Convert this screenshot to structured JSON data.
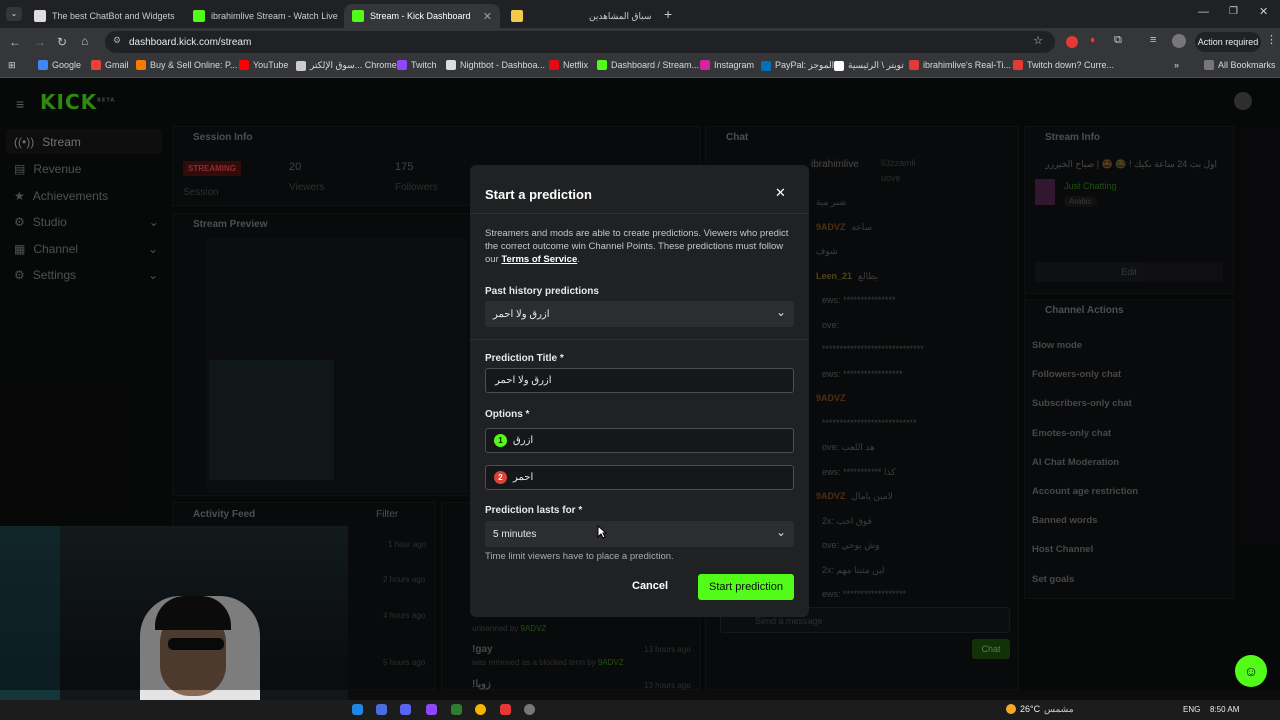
{
  "browser": {
    "tabs": [
      {
        "title": "The best ChatBot and Widgets",
        "color": "#ffffff"
      },
      {
        "title": "ibrahimlive Stream - Watch Live",
        "color": "#53fc18"
      },
      {
        "title": "Stream - Kick Dashboard",
        "color": "#53fc18"
      },
      {
        "title": "سباق المشاهدين",
        "color": "#f2c94c"
      }
    ],
    "url": "dashboard.kick.com/stream",
    "action_required": "Action required",
    "bookmarks": [
      "Google",
      "Gmail",
      "Buy & Sell Online: P...",
      "YouTube",
      "سوق الإلكتر... Chrome",
      "Twitch",
      "Nightbot - Dashboa...",
      "Netflix",
      "Dashboard / Stream...",
      "Instagram",
      "PayPal: الموجز",
      "تويتر \\ الرئيسية",
      "ibrahimlive's Real-Ti...",
      "Twitch down? Curre..."
    ],
    "all_bookmarks": "All Bookmarks"
  },
  "kick": {
    "logo": "KICK",
    "logo_sup": "BETA",
    "sidebar": [
      "Stream",
      "Revenue",
      "Achievements",
      "Studio",
      "Channel",
      "Settings"
    ],
    "session": {
      "title": "Session Info",
      "badge": "STREAMING",
      "session_label": "Session",
      "viewers": "20",
      "viewers_label": "Viewers",
      "followers": "175",
      "followers_label": "Followers"
    },
    "preview_title": "Stream Preview",
    "activity": {
      "title": "Activity Feed",
      "filter": "Filter",
      "times": [
        "1 hour ago",
        "2 hours ago",
        "4 hours ago",
        "5 hours ago"
      ]
    },
    "mod_feed": [
      {
        "text": "unbanned by",
        "user": "9ADVZ",
        "time": ""
      },
      {
        "text": "!gay",
        "sub": "was removed as a blocked term by",
        "user": "9ADVZ",
        "time": "13 hours ago"
      },
      {
        "text": "!زوبا",
        "time": "13 hours ago"
      }
    ],
    "chat": {
      "title": "Chat",
      "top_users": [
        "ibrahimlive",
        "li3zzamli",
        "uove"
      ],
      "messages": [
        {
          "user": "",
          "text": "شبر مية",
          "color": "#f48c1f"
        },
        {
          "user": "9ADVZ",
          "text": "ساعه",
          "color": "#f48c1f"
        },
        {
          "user": "",
          "text": "شوف",
          "color": "#ffffff"
        },
        {
          "user": "Leen_21",
          "text": "يطالع",
          "color": "#f2d542"
        },
        {
          "user": "",
          "text": "ews: ***************",
          "color": "#53fc18"
        },
        {
          "user": "",
          "text": "ove:",
          "color": "#3fa4ff"
        },
        {
          "user": "",
          "text": "*****************************",
          "color": "#53fc18"
        },
        {
          "user": "",
          "text": "ews: *****************",
          "color": "#53fc18"
        },
        {
          "user": "9ADVZ",
          "text": "",
          "color": "#f48c1f"
        },
        {
          "user": "",
          "text": "***************************",
          "color": "#53fc18"
        },
        {
          "user": "",
          "text": "ove: هد اللعب",
          "color": "#3fa4ff"
        },
        {
          "user": "",
          "text": "ews: *********** كذا",
          "color": "#53fc18"
        },
        {
          "user": "9ADVZ",
          "text": "لامين يامال",
          "color": "#f48c1f"
        },
        {
          "user": "",
          "text": "2x: فوق احب",
          "color": "#e53935"
        },
        {
          "user": "",
          "text": "ove: وش يوحي",
          "color": "#3fa4ff"
        },
        {
          "user": "",
          "text": "2x: لين مثبتا مهم",
          "color": "#e53935"
        },
        {
          "user": "",
          "text": "ews: ******************",
          "color": "#53fc18"
        }
      ],
      "placeholder": "Send a message",
      "send": "Chat"
    },
    "stream_info": {
      "title": "Stream Info",
      "stream_title": "اول بث 24 ساعة بكيك ! 😂 🤩 | صباح الخيررر",
      "category": "Just Chatting",
      "language": "Arabic",
      "edit": "Edit"
    },
    "channel_actions": {
      "title": "Channel Actions",
      "items": [
        "Slow mode",
        "Followers-only chat",
        "Subscribers-only chat",
        "Emotes-only chat",
        "AI Chat Moderation",
        "Account age restriction",
        "Banned words",
        "Host Channel",
        "Set goals"
      ]
    }
  },
  "modal": {
    "title": "Start a prediction",
    "description": "Streamers and mods are able to create predictions. Viewers who predict the correct outcome win Channel Points. These predictions must follow our",
    "tos": "Terms of Service",
    "history_label": "Past history predictions",
    "history_value": "ازرق ولا احمر",
    "title_label": "Prediction Title *",
    "title_value": "ازرق ولا احمر",
    "options_label": "Options *",
    "options": [
      {
        "num": "1",
        "value": "ازرق",
        "color": "#53fc18"
      },
      {
        "num": "2",
        "value": "احمر",
        "color": "#d9433a"
      }
    ],
    "duration_label": "Prediction lasts for *",
    "duration_value": "5 minutes",
    "duration_help": "Time limit viewers have to place a prediction.",
    "cancel": "Cancel",
    "submit": "Start prediction",
    "accent": "#53fc18"
  },
  "taskbar": {
    "weather": "26°C",
    "weather_text": "مشمس",
    "lang": "ENG",
    "time": "8:50 AM"
  }
}
